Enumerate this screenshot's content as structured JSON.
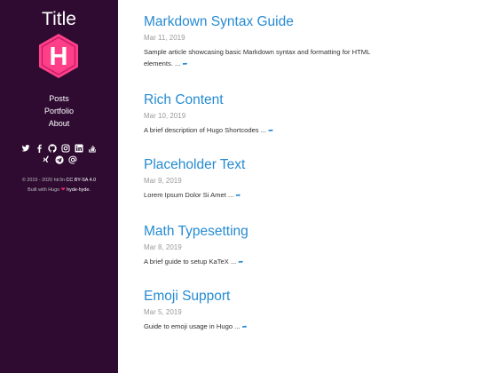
{
  "site": {
    "title": "Title",
    "logo_letter": "H"
  },
  "nav": {
    "posts": "Posts",
    "portfolio": "Portfolio",
    "about": "About"
  },
  "footer": {
    "copyright": "© 2019 - 2020 htr3n",
    "license": "CC BY-SA 4.0",
    "built_with": "Built with Hugo",
    "heart": "❤",
    "theme": "hyde-hyde."
  },
  "posts": [
    {
      "title": "Markdown Syntax Guide",
      "date": "Mar 11, 2019",
      "summary": "Sample article showcasing basic Markdown syntax and formatting for HTML elements. ...",
      "more": "➦"
    },
    {
      "title": "Rich Content",
      "date": "Mar 10, 2019",
      "summary": "A brief description of Hugo Shortcodes ...",
      "more": "➦"
    },
    {
      "title": "Placeholder Text",
      "date": "Mar 9, 2019",
      "summary": "Lorem Ipsum Dolor Si Amet ...",
      "more": "➦"
    },
    {
      "title": "Math Typesetting",
      "date": "Mar 8, 2019",
      "summary": "A brief guide to setup KaTeX ...",
      "more": "➦"
    },
    {
      "title": "Emoji Support",
      "date": "Mar 5, 2019",
      "summary": "Guide to emoji usage in Hugo ...",
      "more": "➦"
    }
  ],
  "colors": {
    "sidebar_bg": "#2f0b32",
    "accent": "#268bd2",
    "logo": "#ff4088"
  },
  "icons": [
    "twitter-icon",
    "facebook-icon",
    "github-icon",
    "instagram-icon",
    "linkedin-icon",
    "stackoverflow-icon",
    "xing-icon",
    "telegram-icon",
    "email-icon"
  ]
}
